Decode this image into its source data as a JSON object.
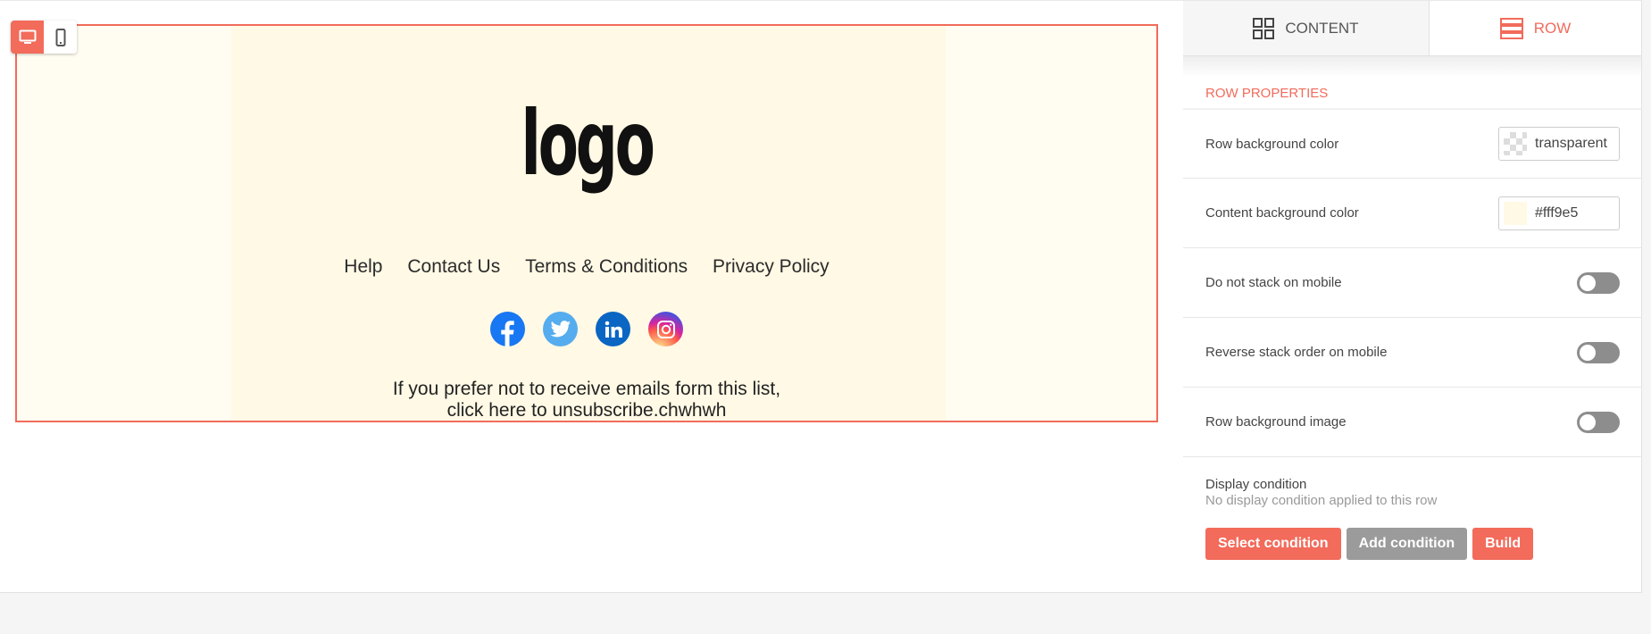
{
  "canvas": {
    "logo_text": "logo",
    "menu_items": [
      "Help",
      "Contact Us",
      "Terms & Conditions",
      "Privacy Policy"
    ],
    "social_icons": [
      "facebook-icon",
      "twitter-icon",
      "linkedin-icon",
      "instagram-icon"
    ],
    "footer_line1": "If you prefer not to receive emails form this list,",
    "footer_line2": "click here to unsubscribe.chwhwh",
    "row_background": "#fffdf1",
    "content_background": "#fff9e5",
    "accent": "#f26b5b"
  },
  "device_toggle": {
    "desktop_icon": "desktop-icon",
    "mobile_icon": "mobile-icon",
    "active": "desktop"
  },
  "panel": {
    "tabs": [
      {
        "label": "CONTENT",
        "icon": "grid-icon"
      },
      {
        "label": "ROW",
        "icon": "rows-icon"
      }
    ],
    "section_title": "ROW PROPERTIES",
    "properties": {
      "row_bg_label": "Row background color",
      "row_bg_value": "transparent",
      "content_bg_label": "Content background color",
      "content_bg_value": "#fff9e5",
      "no_stack_label": "Do not stack on mobile",
      "reverse_stack_label": "Reverse stack order on mobile",
      "row_bg_image_label": "Row background image"
    },
    "display_condition": {
      "title": "Display condition",
      "subtitle": "No display condition applied to this row",
      "buttons": [
        "Select condition",
        "Add condition",
        "Build"
      ]
    }
  }
}
